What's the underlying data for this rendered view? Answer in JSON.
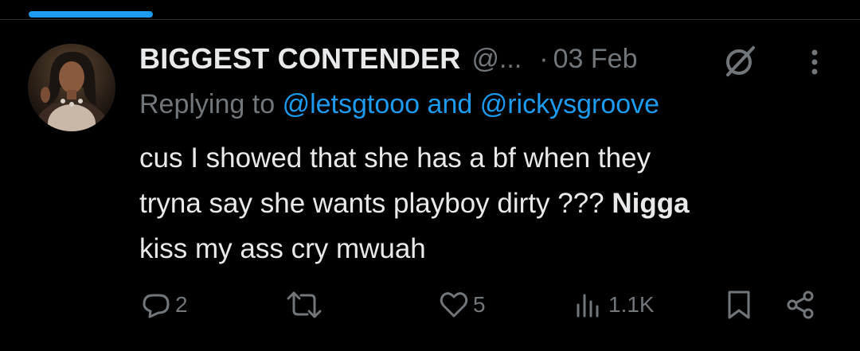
{
  "tweet": {
    "display_name": "BIGGEST CONTENDER",
    "handle": "@...",
    "separator": "·",
    "date": "03 Feb",
    "reply_prefix": "Replying to",
    "reply_mention_1": "@letsgtooo",
    "reply_and": "and",
    "reply_mention_2": "@rickysgroove",
    "body_line_1": "cus I showed that she has a bf when they",
    "body_line_2": "tryna say she wants playboy dirty ???",
    "body_bold": "Nigga",
    "body_line_3": "kiss my ass cry mwuah"
  },
  "actions": {
    "reply_count": "2",
    "repost_count": "",
    "like_count": "5",
    "views_count": "1.1K"
  },
  "colors": {
    "background": "#000000",
    "text_primary": "#e7e9ea",
    "text_secondary": "#71767b",
    "accent": "#1d9bf0"
  },
  "icons": [
    "grok-icon",
    "more-icon",
    "reply-icon",
    "repost-icon",
    "like-icon",
    "views-icon",
    "bookmark-icon",
    "share-icon"
  ]
}
